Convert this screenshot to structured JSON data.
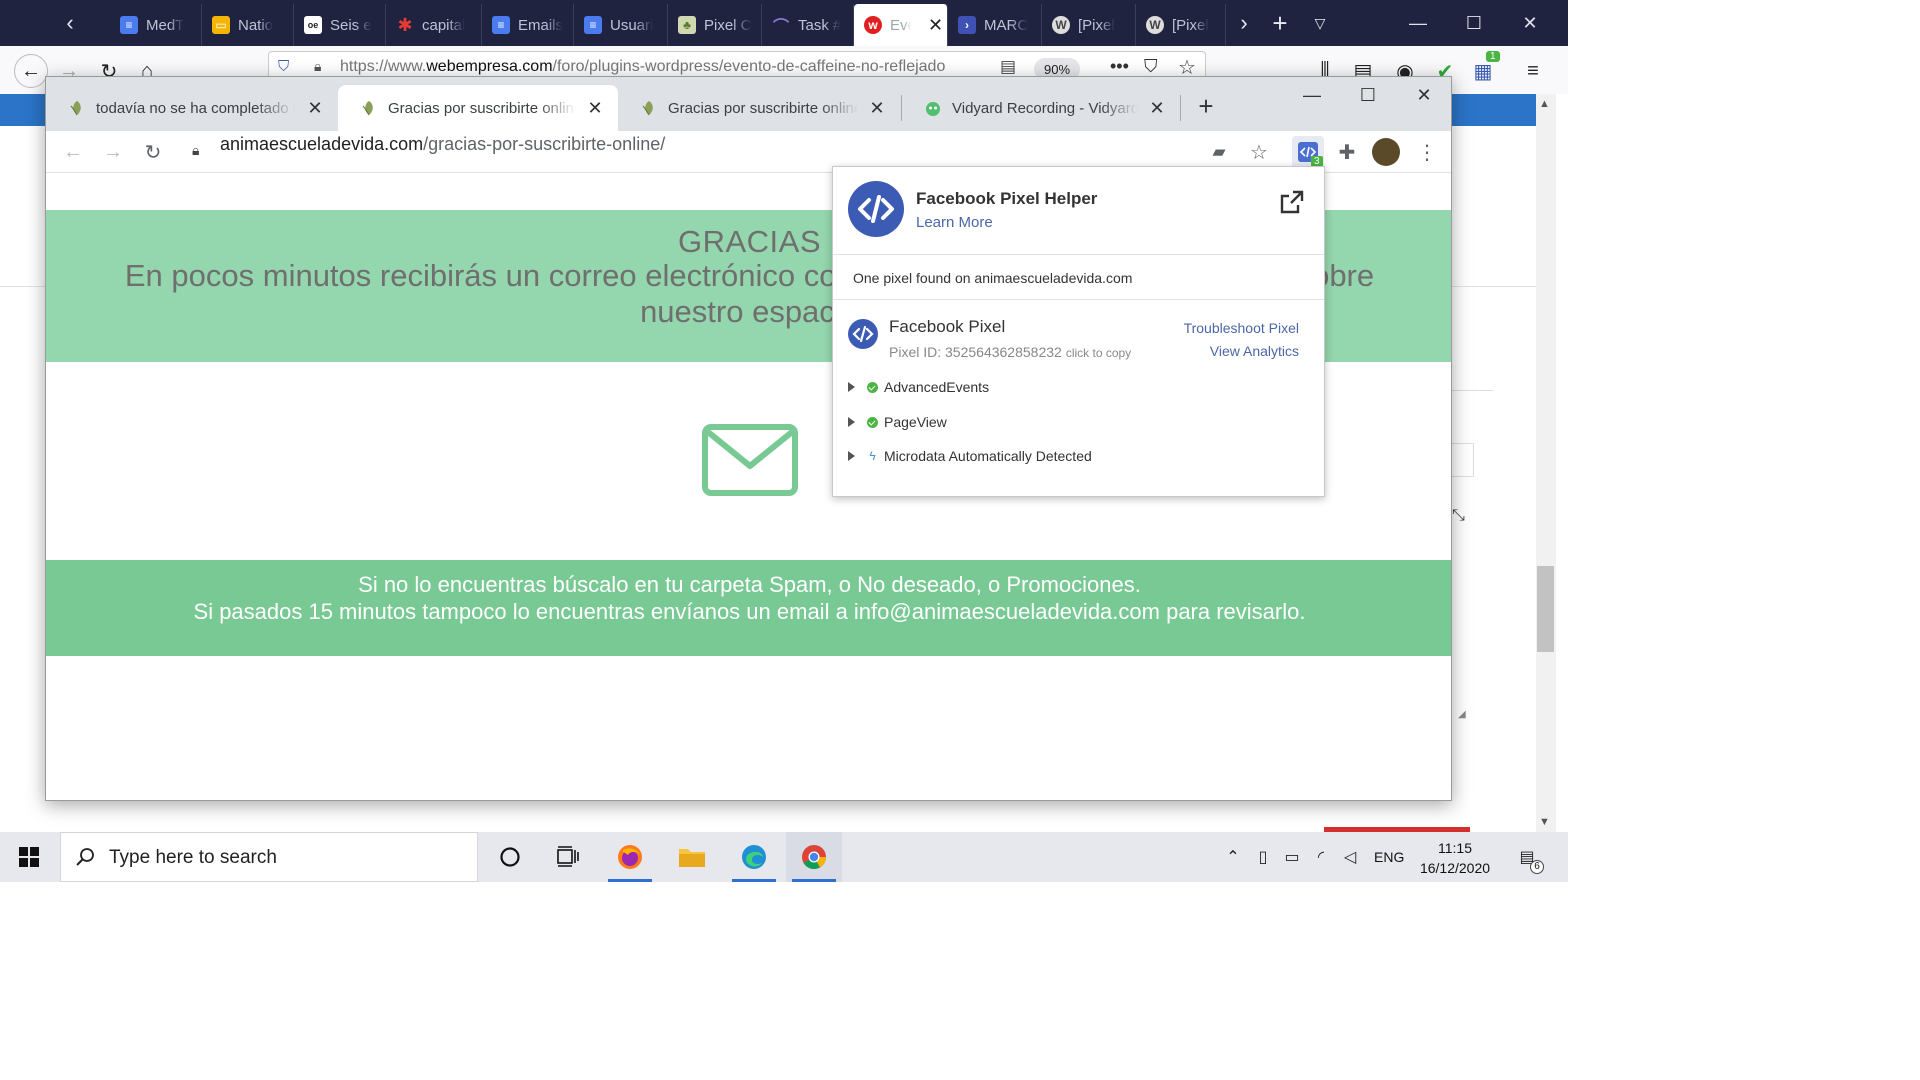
{
  "firefox": {
    "tabs": [
      {
        "label": "MedT",
        "icon": "docs-icon",
        "color": "#4a7cf0"
      },
      {
        "label": "Natio",
        "icon": "slides-icon",
        "color": "#f4b400"
      },
      {
        "label": "Seis e",
        "icon": "oe-icon",
        "color": "#ffffff"
      },
      {
        "label": "capital",
        "icon": "asterisk-icon",
        "color": "#e53935"
      },
      {
        "label": "Emails",
        "icon": "docs-icon",
        "color": "#4a7cf0"
      },
      {
        "label": "Usuari",
        "icon": "docs-icon",
        "color": "#4a7cf0"
      },
      {
        "label": "Pixel C",
        "icon": "leaf-icon",
        "color": "#8aa05a"
      },
      {
        "label": "Task #",
        "icon": "arc-icon",
        "color": "#6a5acd"
      },
      {
        "label": "Eve",
        "icon": "webempresa-icon",
        "color": "#e02020"
      },
      {
        "label": "MARC",
        "icon": "chevron-app-icon",
        "color": "#3f51b5"
      },
      {
        "label": "[Pixel",
        "icon": "wordpress-icon",
        "color": "#555555"
      },
      {
        "label": "[Pixel",
        "icon": "wordpress-icon",
        "color": "#555555"
      }
    ],
    "url_prefix": "https://www.",
    "url_domain": "webempresa.com",
    "url_path": "/foro/plugins-wordpress/evento-de-caffeine-no-reflejado",
    "zoom": "90%",
    "extension_badge": "1"
  },
  "chrome": {
    "tabs": [
      {
        "label": "todavía no se ha completado o",
        "close": "✕"
      },
      {
        "label": "Gracias por suscribirte online -",
        "close": "✕"
      },
      {
        "label": "Gracias por suscribirte online -",
        "close": "✕"
      },
      {
        "label": "Vidyard Recording - Vidyard",
        "close": "✕"
      }
    ],
    "new_tab": "+",
    "url": "animaescueladevida.com",
    "url_path": "/gracias-por-suscribirte-online/",
    "extension_badge": "3"
  },
  "page": {
    "heading": "GRACIAS",
    "band1_text": "En pocos minutos recibirás un correo electrónico con el acceso y toda la información sobre nuestro espacio",
    "band2_line1": "Si no lo encuentras búscalo en tu carpeta Spam, o No deseado, o Promociones.",
    "band2_line2": "Si pasados 15 minutos tampoco lo encuentras envíanos un email a info@animaescueladevida.com para revisarlo.",
    "band1_color": "#94d6ad",
    "band2_color": "#78c994"
  },
  "pixel_helper": {
    "title": "Facebook Pixel Helper",
    "learn_more": "Learn More",
    "found_text": "One pixel found on animaescueladevida.com",
    "pixel_name": "Facebook Pixel",
    "pixel_id": "Pixel ID: 352564362858232",
    "click_to_copy": "click to copy",
    "troubleshoot": "Troubleshoot Pixel",
    "view_analytics": "View Analytics",
    "events": [
      {
        "label": "AdvancedEvents",
        "status": "ok"
      },
      {
        "label": "PageView",
        "status": "ok"
      },
      {
        "label": "Microdata Automatically Detected",
        "status": "info"
      }
    ]
  },
  "taskbar": {
    "search_placeholder": "Type here to search",
    "lang": "ENG",
    "time": "11:15",
    "date": "16/12/2020",
    "notification_count": "6"
  }
}
